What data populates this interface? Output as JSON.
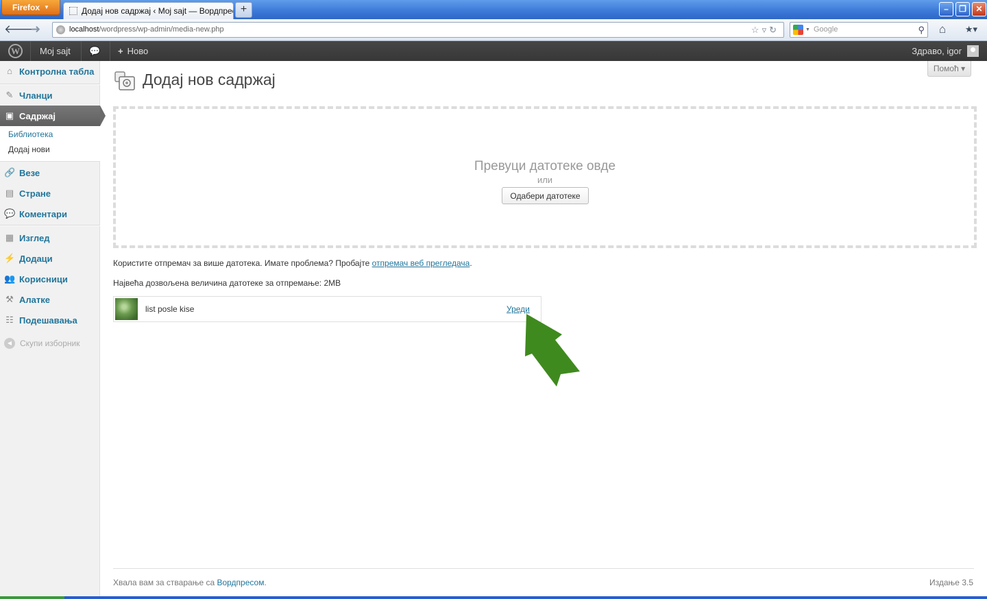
{
  "browser": {
    "menu_button": "Firefox",
    "tab_title": "Додај нов садржај ‹ Moj sajt — Вордпрес",
    "new_tab": "+",
    "url_host": "localhost",
    "url_path": "/wordpress/wp-admin/media-new.php",
    "search_placeholder": "Google"
  },
  "adminbar": {
    "site_name": "Moj sajt",
    "new_label": "Ново",
    "greeting": "Здраво, igor"
  },
  "sidebar": {
    "items": [
      {
        "label": "Контролна табла",
        "icon": "home-icon"
      },
      {
        "label": "Чланци",
        "icon": "pin-icon"
      },
      {
        "label": "Садржај",
        "icon": "media-icon"
      },
      {
        "label": "Везе",
        "icon": "link-icon"
      },
      {
        "label": "Стране",
        "icon": "page-icon"
      },
      {
        "label": "Коментари",
        "icon": "comment-icon"
      },
      {
        "label": "Изглед",
        "icon": "appearance-icon"
      },
      {
        "label": "Додаци",
        "icon": "plugin-icon"
      },
      {
        "label": "Корисници",
        "icon": "users-icon"
      },
      {
        "label": "Алатке",
        "icon": "tools-icon"
      },
      {
        "label": "Подешавања",
        "icon": "settings-icon"
      }
    ],
    "submenu": {
      "library": "Библиотека",
      "add_new": "Додај нови"
    },
    "collapse": "Скупи изборник"
  },
  "main": {
    "help": "Помоћ",
    "title": "Додај нов садржај",
    "drop_text": "Превуци датотеке овде",
    "drop_or": "или",
    "select_button": "Одабери датотеке",
    "uploader_text": "Користите отпремач за више датотека. Имате проблема? Пробајте ",
    "uploader_link": "отпремач веб прегледача",
    "uploader_end": ".",
    "max_size": "Највећа дозвољена величина датотеке за отпремање: 2MB",
    "media_item": {
      "filename": "list posle kise",
      "edit_link": "Уреди"
    }
  },
  "footer": {
    "thanks_text": "Хвала вам за стварање са ",
    "thanks_link": "Вордпресом",
    "thanks_end": ".",
    "version": "Издање 3.5"
  },
  "colors": {
    "link": "#21759b",
    "adminbar": "#464646",
    "active_menu": "#6a6a6a",
    "arrow": "#3f8a1f"
  }
}
